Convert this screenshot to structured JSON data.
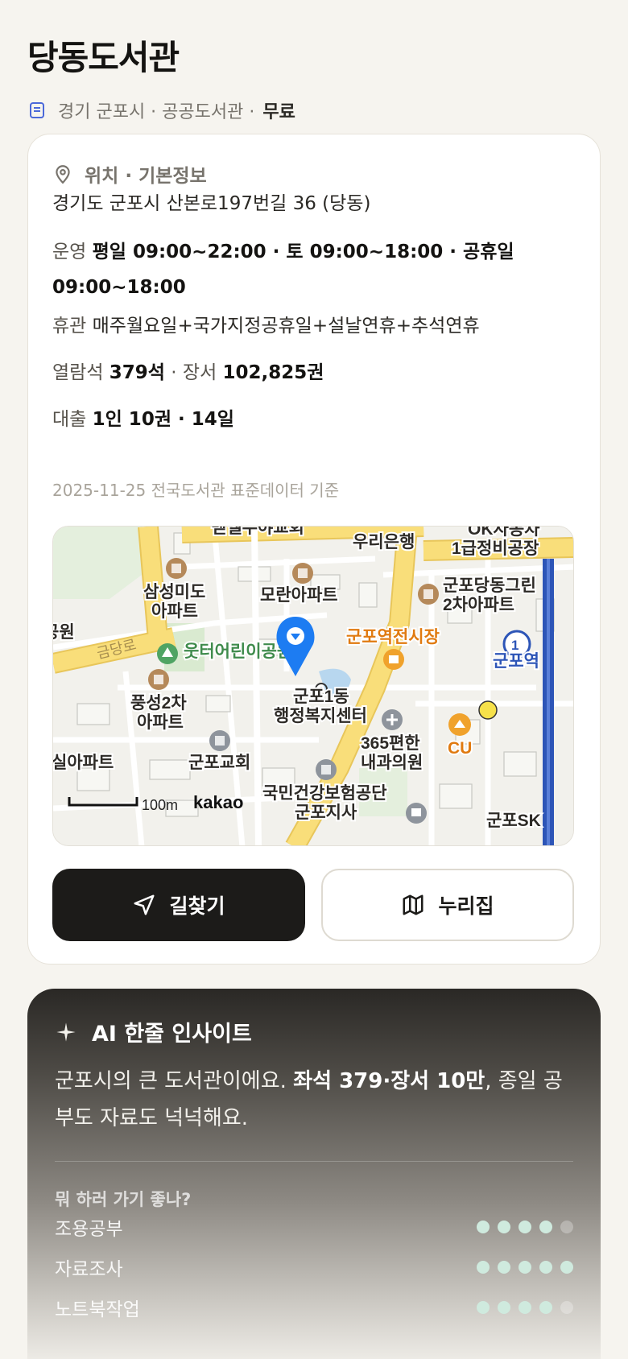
{
  "header": {
    "title": "당동도서관",
    "region": "경기 군포시 · 공공도서관 ·",
    "fee": "무료"
  },
  "info": {
    "section_title": "위치 · 기본정보",
    "address": "경기도 군포시 산본로197번길 36 (당동)",
    "hours_label": "운영",
    "hours_value": "평일 09:00~22:00 · 토 09:00~18:00 · 공휴일 09:00~18:00",
    "closed_label": "휴관",
    "closed_value": "매주월요일+국가지정공휴일+설날연휴+추석연휴",
    "seats_label": "열람석",
    "seats_value": "379석",
    "books_label": "· 장서",
    "books_value": "102,825권",
    "loan_label": "대출",
    "loan_value": "1인 10권 · 14일",
    "source_note": "2025-11-25 전국도서관 표준데이터 기준"
  },
  "map": {
    "labels": {
      "church_top": "벧엘누야교회",
      "bank": "우리은행",
      "repair": "OK자동차",
      "repair2": "1급정비공장",
      "samsung": "삼성미도",
      "samsung2": "아파트",
      "moran": "모란아파트",
      "gunpo_dang": "군포당동그린",
      "gunpo_dang2": "2차아파트",
      "park": "공원",
      "road": "금당로",
      "kids_park": "웃터어린이공원",
      "market": "군포역전시장",
      "station": "군포역",
      "pungseong": "풍성2차",
      "pungseong2": "아파트",
      "center": "군포1동",
      "center2": "행정복지센터",
      "clinic": "365편한",
      "clinic2": "내과의원",
      "cu": "CU",
      "apt_left": "실아파트",
      "church": "군포교회",
      "nhis": "국민건강보험공단",
      "nhis2": "군포지사",
      "station_bottom": "군포SK",
      "scale": "100m",
      "brand": "kakao",
      "line_number": "1"
    }
  },
  "buttons": {
    "directions": "길찾기",
    "nurijip": "누리집"
  },
  "ai": {
    "title": "AI 한줄 인사이트",
    "text_pre": "군포시의 큰 도서관이에요. ",
    "text_bold": "좌석 379·장서 10만",
    "text_post": ", 종일 공부도 자료도 넉넉해요.",
    "question": "뭐 하러 가기 좋나?",
    "ratings": [
      {
        "label": "조용공부",
        "score": 4,
        "max": 5
      },
      {
        "label": "자료조사",
        "score": 5,
        "max": 5
      },
      {
        "label": "노트북작업",
        "score": 4,
        "max": 5
      }
    ]
  },
  "colors": {
    "accent_dark": "#1c1b19",
    "pin": "#1d7cf2",
    "dot_on": "#cfeade",
    "road_yellow": "#f9de7a"
  }
}
